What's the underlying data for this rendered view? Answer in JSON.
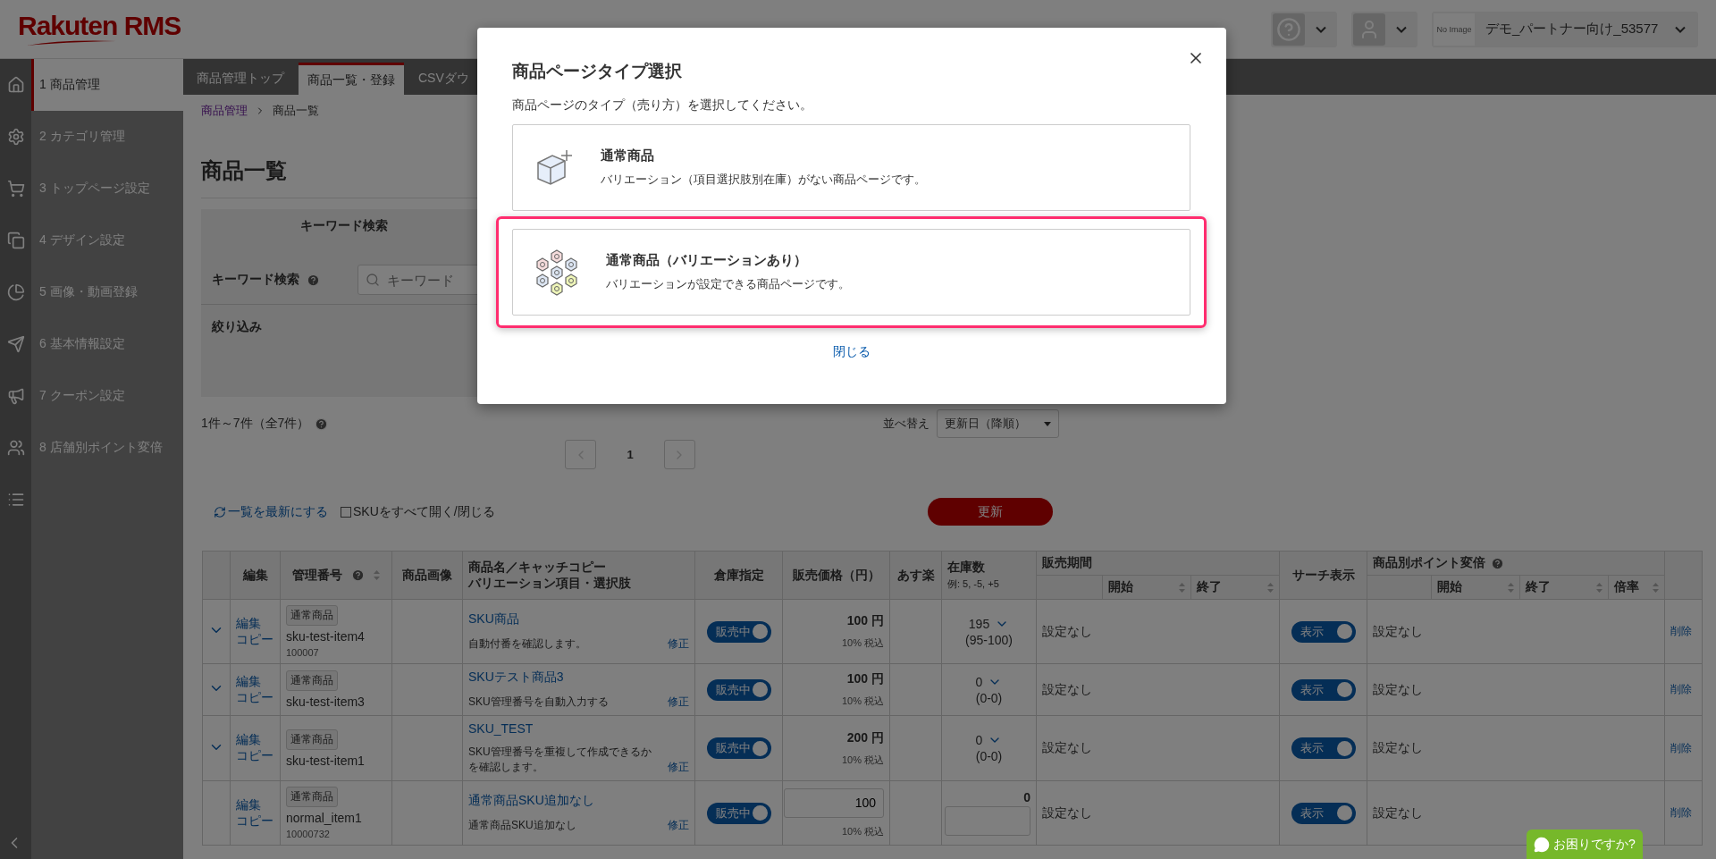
{
  "header": {
    "logo": "Rakuten RMS",
    "help_menu": {
      "expanded": false
    },
    "user_menu": {
      "expanded": false
    },
    "store": {
      "thumbnail_text": "No Image",
      "name": "デモ_パートナー向け_53577"
    }
  },
  "sidebar": {
    "items": [
      {
        "label": "1 商品管理",
        "selected": true
      },
      {
        "label": "2 カテゴリ管理",
        "selected": false
      },
      {
        "label": "3 トップページ設定",
        "selected": false
      },
      {
        "label": "4 デザイン設定",
        "selected": false
      },
      {
        "label": "5 画像・動画登録",
        "selected": false
      },
      {
        "label": "6 基本情報設定",
        "selected": false
      },
      {
        "label": "7 クーポン設定",
        "selected": false
      },
      {
        "label": "8 店舗別ポイント変倍",
        "selected": false
      },
      {
        "selected": false
      }
    ]
  },
  "tabs": [
    {
      "label": "商品管理トップ",
      "selected": false
    },
    {
      "label": "商品一覧・登録",
      "selected": true
    },
    {
      "label": "CSVダウ",
      "selected": false
    }
  ],
  "breadcrumb": [
    {
      "label": "商品管理",
      "link": true
    },
    {
      "label": "商品一覧",
      "link": false
    }
  ],
  "page_title": "商品一覧",
  "search_panel": {
    "heading": "キーワード検索",
    "field_label": "キーワード検索",
    "placeholder": "キーワード",
    "filter_label": "絞り込み"
  },
  "result_count": "1件～7件（全7件）",
  "sort": {
    "label": "並べ替え",
    "value": "更新日（降順）"
  },
  "pagination": {
    "current": "1"
  },
  "refresh_link": "一覧を最新にする",
  "sku_toggle": {
    "label": "SKUをすべて開く/閉じる",
    "checked": false
  },
  "update_button": "更新",
  "table": {
    "columns": [
      {
        "label": "編集"
      },
      {
        "label": "管理番号",
        "help": true,
        "sortable": true
      },
      {
        "label": "商品画像"
      },
      {
        "label": "商品名／キャッチコピー",
        "label2": "バリエーション項目・選択肢"
      },
      {
        "label": "倉庫指定"
      },
      {
        "label": "販売価格（円）"
      },
      {
        "label": "あす楽"
      },
      {
        "label": "在庫数",
        "hint": "例: 5, -5, +5"
      },
      {
        "label": "販売期間",
        "sub": [
          {
            "label": "開始",
            "sortable": true
          },
          {
            "label": "終了",
            "sortable": true
          }
        ]
      },
      {
        "label": "サーチ表示"
      },
      {
        "label": "商品別ポイント変倍",
        "help": true,
        "sub": [
          {
            "label": "開始",
            "sortable": true
          },
          {
            "label": "終了",
            "sortable": true
          },
          {
            "label": "倍率",
            "sortable": true
          }
        ]
      }
    ],
    "rows": [
      {
        "kind": "variation",
        "edit": "編集",
        "copy": "コピー",
        "badge": "通常商品",
        "code": "sku-test-item4",
        "number": "100007",
        "name": "SKU商品",
        "catch": "自動付番を確認します。",
        "fix": "修正",
        "warehouse": {
          "label": "販売中",
          "on": true
        },
        "price": "100 円",
        "tax": "10% 税込",
        "stock": "195",
        "stock_range": "(95-100)",
        "sale_period": "設定なし",
        "search": {
          "label": "表示",
          "on": true
        },
        "point": "設定なし",
        "delete": "削除"
      },
      {
        "kind": "variation",
        "edit": "編集",
        "copy": "コピー",
        "badge": "通常商品",
        "code": "sku-test-item3",
        "name": "SKUテスト商品3",
        "catch": "SKU管理番号を自動入力する",
        "fix": "修正",
        "warehouse": {
          "label": "販売中",
          "on": true
        },
        "price": "100 円",
        "tax": "10% 税込",
        "stock": "0",
        "stock_range": "(0-0)",
        "sale_period": "設定なし",
        "search": {
          "label": "表示",
          "on": true
        },
        "point": "設定なし",
        "delete": "削除"
      },
      {
        "kind": "variation",
        "edit": "編集",
        "copy": "コピー",
        "badge": "通常商品",
        "code": "sku-test-item1",
        "name": "SKU_TEST",
        "catch": "SKU管理番号を重複して作成できるかを確認します。",
        "fix": "修正",
        "warehouse": {
          "label": "販売中",
          "on": true
        },
        "price": "200 円",
        "tax": "10% 税込",
        "stock": "0",
        "stock_range": "(0-0)",
        "sale_period": "設定なし",
        "search": {
          "label": "表示",
          "on": true
        },
        "point": "設定なし",
        "delete": "削除"
      },
      {
        "kind": "normal",
        "edit": "編集",
        "copy": "コピー",
        "badge": "通常商品",
        "code": "normal_item1",
        "number": "10000732",
        "name": "通常商品SKU追加なし",
        "catch": "通常商品SKU追加なし",
        "fix": "修正",
        "warehouse": {
          "label": "販売中",
          "on": true
        },
        "price": "100",
        "tax": "10% 税込",
        "stock": "0",
        "sale_period": "設定なし",
        "search": {
          "label": "表示",
          "on": true
        },
        "point": "設定なし",
        "delete": "削除"
      }
    ]
  },
  "modal": {
    "title": "商品ページタイプ選択",
    "subtitle": "商品ページのタイプ（売り方）を選択してください。",
    "options": [
      {
        "kind": "single",
        "title": "通常商品",
        "description": "バリエーション（項目選択肢別在庫）がない商品ページです。",
        "highlighted": false
      },
      {
        "kind": "variation",
        "title": "通常商品（バリエーションあり）",
        "description": "バリエーションが設定できる商品ページです。",
        "highlighted": true
      }
    ],
    "close_link": "閉じる"
  },
  "chat_button": "お困りですか?"
}
